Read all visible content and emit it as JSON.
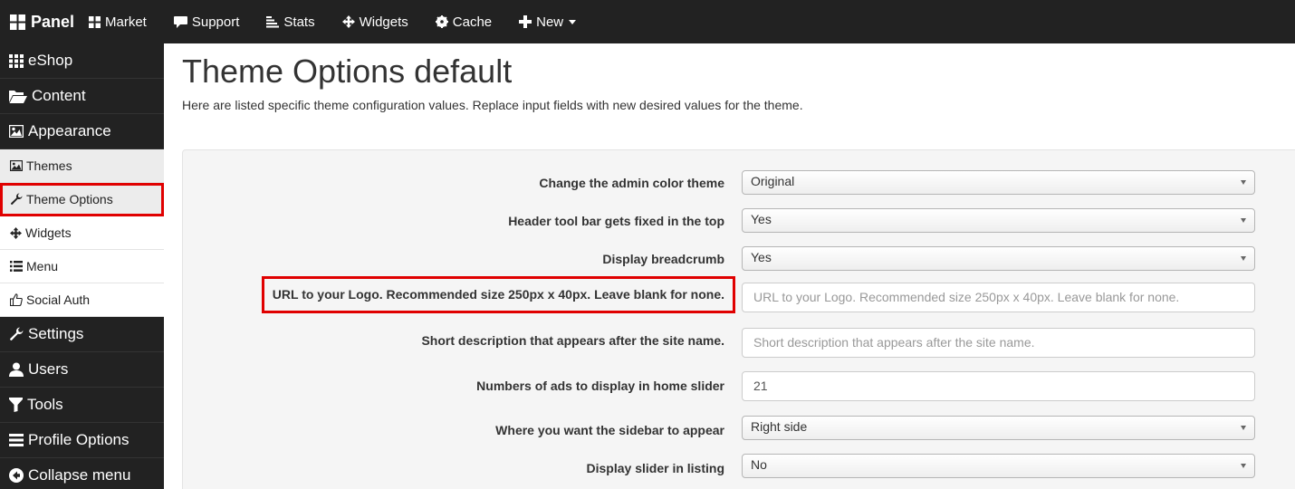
{
  "topnav": {
    "brand": "Panel",
    "items": [
      {
        "label": "Market",
        "icon": "grid-small-icon"
      },
      {
        "label": "Support",
        "icon": "comment-icon"
      },
      {
        "label": "Stats",
        "icon": "bars-icon"
      },
      {
        "label": "Widgets",
        "icon": "move-icon"
      },
      {
        "label": "Cache",
        "icon": "gear-icon"
      },
      {
        "label": "New",
        "icon": "plus-icon"
      }
    ]
  },
  "sidebar": {
    "main_top": [
      {
        "label": "eShop",
        "icon": "grid-icon"
      },
      {
        "label": "Content",
        "icon": "folder-open-icon"
      },
      {
        "label": "Appearance",
        "icon": "picture-icon"
      }
    ],
    "sub": [
      {
        "label": "Themes",
        "icon": "picture-icon"
      },
      {
        "label": "Theme Options",
        "icon": "wrench-icon"
      },
      {
        "label": "Widgets",
        "icon": "move-icon"
      },
      {
        "label": "Menu",
        "icon": "list-icon"
      },
      {
        "label": "Social Auth",
        "icon": "thumbs-up-icon"
      }
    ],
    "main_bottom": [
      {
        "label": "Settings",
        "icon": "wrench-icon"
      },
      {
        "label": "Users",
        "icon": "user-icon"
      },
      {
        "label": "Tools",
        "icon": "filter-icon"
      },
      {
        "label": "Profile Options",
        "icon": "list-icon"
      },
      {
        "label": "Collapse menu",
        "icon": "circle-left-icon"
      }
    ]
  },
  "page": {
    "title": "Theme Options default",
    "description": "Here are listed specific theme configuration values. Replace input fields with new desired values for the theme."
  },
  "form": {
    "admin_color": {
      "label": "Change the admin color theme",
      "value": "Original"
    },
    "header_fixed": {
      "label": "Header tool bar gets fixed in the top",
      "value": "Yes"
    },
    "breadcrumb": {
      "label": "Display breadcrumb",
      "value": "Yes"
    },
    "logo_url": {
      "label": "URL to your Logo. Recommended size 250px x 40px. Leave blank for none.",
      "placeholder": "URL to your Logo. Recommended size 250px x 40px. Leave blank for none."
    },
    "short_desc": {
      "label": "Short description that appears after the site name.",
      "placeholder": "Short description that appears after the site name."
    },
    "num_ads": {
      "label": "Numbers of ads to display in home slider",
      "value": "21"
    },
    "sidebar_position": {
      "label": "Where you want the sidebar to appear",
      "value": "Right side"
    },
    "slider_listing": {
      "label": "Display slider in listing",
      "value": "No"
    }
  },
  "colors": {
    "navbar": "#222222",
    "highlight": "#e00000",
    "panel": "#f5f5f5"
  }
}
